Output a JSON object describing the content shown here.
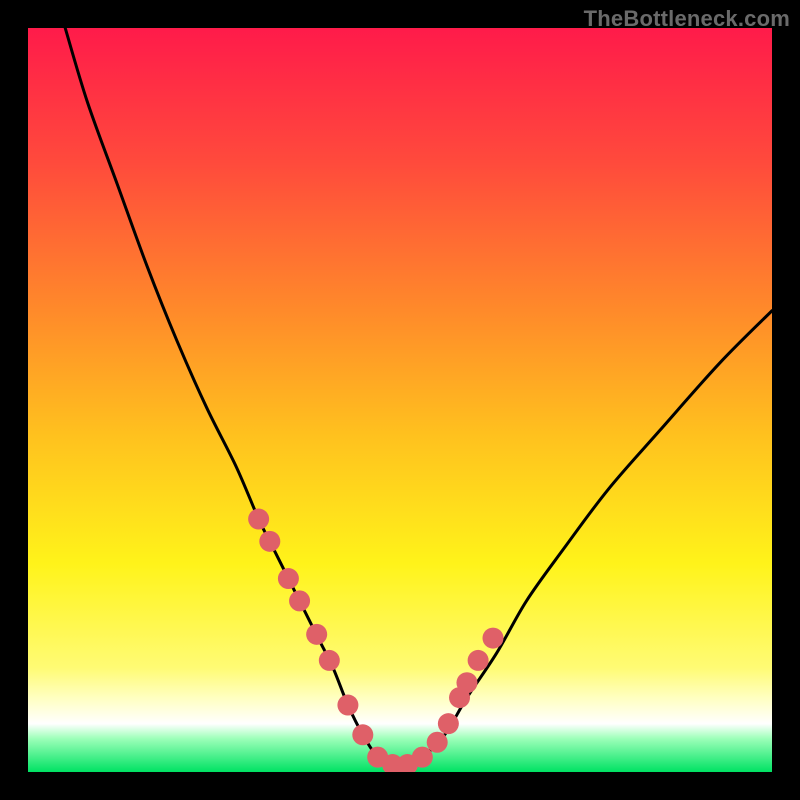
{
  "attribution": "TheBottleneck.com",
  "colors": {
    "frame": "#000000",
    "curve": "#000000",
    "marker_fill": "#df6068",
    "green_band": "#00e263",
    "gradient_stops": [
      {
        "offset": 0.0,
        "color": "#ff1b4a"
      },
      {
        "offset": 0.18,
        "color": "#ff4a3c"
      },
      {
        "offset": 0.38,
        "color": "#ff8a2a"
      },
      {
        "offset": 0.55,
        "color": "#ffc21e"
      },
      {
        "offset": 0.72,
        "color": "#fff31a"
      },
      {
        "offset": 0.86,
        "color": "#fffb74"
      },
      {
        "offset": 0.9,
        "color": "#ffffc0"
      },
      {
        "offset": 0.935,
        "color": "#ffffff"
      },
      {
        "offset": 0.955,
        "color": "#9dffb9"
      },
      {
        "offset": 1.0,
        "color": "#00e263"
      }
    ]
  },
  "chart_data": {
    "type": "line",
    "title": "",
    "xlabel": "",
    "ylabel": "",
    "xlim": [
      0,
      100
    ],
    "ylim": [
      0,
      100
    ],
    "grid": false,
    "legend": false,
    "series": [
      {
        "name": "bottleneck-curve",
        "x": [
          5,
          8,
          12,
          16,
          20,
          24,
          28,
          31,
          33,
          35,
          37,
          39,
          41,
          43,
          45,
          47,
          49,
          51,
          53,
          56,
          59,
          63,
          67,
          72,
          78,
          85,
          93,
          100
        ],
        "values": [
          100,
          90,
          79,
          68,
          58,
          49,
          41,
          34,
          30,
          26,
          22,
          18,
          14,
          9,
          5,
          2,
          1,
          1,
          2,
          5,
          10,
          16,
          23,
          30,
          38,
          46,
          55,
          62
        ]
      }
    ],
    "markers": {
      "name": "highlighted-points",
      "x": [
        31.0,
        32.5,
        35.0,
        36.5,
        38.8,
        40.5,
        43.0,
        45.0,
        47.0,
        49.0,
        51.0,
        53.0,
        55.0,
        56.5,
        58.0,
        59.0,
        60.5,
        62.5
      ],
      "values": [
        34.0,
        31.0,
        26.0,
        23.0,
        18.5,
        15.0,
        9.0,
        5.0,
        2.0,
        1.0,
        1.0,
        2.0,
        4.0,
        6.5,
        10.0,
        12.0,
        15.0,
        18.0
      ]
    }
  }
}
